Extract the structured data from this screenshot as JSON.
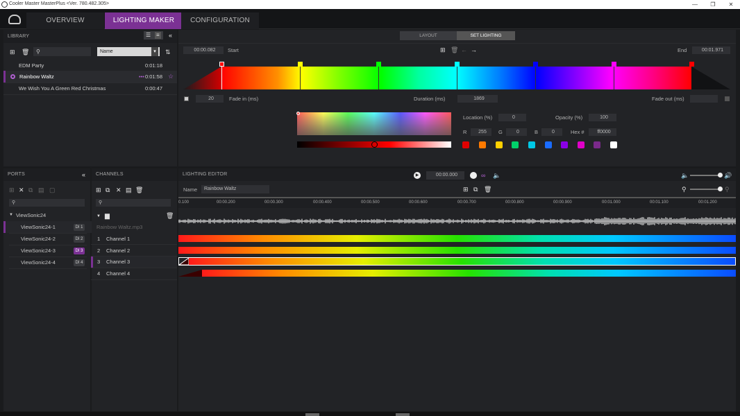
{
  "window": {
    "title": "Cooler Master MasterPlus  <Ver. 780.482.305>"
  },
  "tabs": [
    {
      "label": "OVERVIEW"
    },
    {
      "label": "LIGHTING MAKER"
    },
    {
      "label": "CONFIGURATION"
    }
  ],
  "library": {
    "header": "LIBRARY",
    "sort_select": "Name",
    "items": [
      {
        "name": "EDM Party",
        "time": "0:01:18"
      },
      {
        "name": "Rainbow Waltz",
        "time": "0:01:58"
      },
      {
        "name": "We Wish You A Green Red Christmas",
        "time": "0:00:47"
      }
    ]
  },
  "mode_switch": {
    "layout": "LAYOUT",
    "set_lighting": "SET LIGHTING"
  },
  "timeline": {
    "start_time": "00:00.082",
    "start_label": "Start",
    "end_label": "End",
    "end_time": "00:01.971",
    "fade_in_value": "20",
    "fade_in_label": "Fade in (ms)",
    "duration_label": "Duration (ms)",
    "duration_value": "1869",
    "fade_out_label": "Fade out (ms)"
  },
  "color_editor": {
    "location_label": "Location (%)",
    "location_value": "0",
    "opacity_label": "Opacity (%)",
    "opacity_value": "100",
    "r_label": "R",
    "r_value": "255",
    "g_label": "G",
    "g_value": "0",
    "b_label": "B",
    "b_value": "0",
    "hex_label": "Hex #",
    "hex_value": "ff0000",
    "swatches": [
      "#e00000",
      "#ff7a00",
      "#ffd000",
      "#00d06a",
      "#00c8e6",
      "#1a6cff",
      "#8a00e6",
      "#e000c8",
      "#7a2a8a",
      "#ffffff"
    ],
    "gradient_stops": [
      "#ff0000",
      "#ffff00",
      "#00ff00",
      "#00ffff",
      "#0000ff",
      "#ff00ff",
      "#ff0000"
    ]
  },
  "ports": {
    "header": "PORTS",
    "group": "ViewSonic24",
    "devices": [
      {
        "name": "ViewSonic24-1",
        "badge": "DI 1"
      },
      {
        "name": "ViewSonic24-2",
        "badge": "DI 2"
      },
      {
        "name": "ViewSonic24-3",
        "badge": "DI 3"
      },
      {
        "name": "ViewSonic24-4",
        "badge": "DI 4"
      }
    ]
  },
  "channels": {
    "header": "CHANNELS",
    "audio_file": "Rainbow Waltz.mp3",
    "items": [
      {
        "num": "1",
        "name": "Channel 1"
      },
      {
        "num": "2",
        "name": "Channel 2"
      },
      {
        "num": "3",
        "name": "Channel 3"
      },
      {
        "num": "4",
        "name": "Channel 4"
      }
    ]
  },
  "editor": {
    "header": "LIGHTING EDITOR",
    "playback_time": "00:00.000",
    "name_label": "Name",
    "name_value": "Rainbow Waltz",
    "ruler": [
      "0.100",
      "00:00.200",
      "00:00.300",
      "00:00.400",
      "00:00.500",
      "00:00.600",
      "00:00.700",
      "00:00.800",
      "00:00.900",
      "00:01.000",
      "00:01.100",
      "00:01.200"
    ]
  },
  "colors": {
    "accent": "#7b3194",
    "background": "#1a1b1d",
    "panel": "#222326"
  }
}
